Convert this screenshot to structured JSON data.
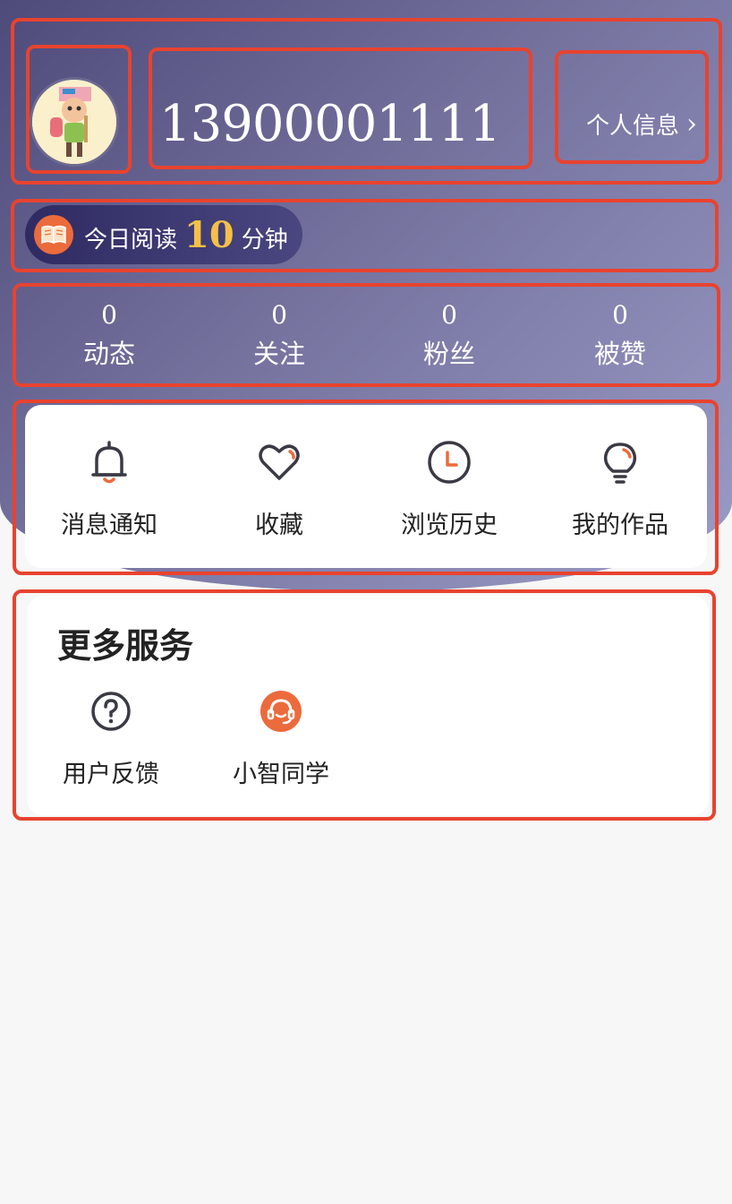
{
  "profile": {
    "phone": "13900001111",
    "info_link_label": "个人信息",
    "chevron": "›",
    "avatar_icon": "cartoon-avatar"
  },
  "reading": {
    "prefix": "今日阅读",
    "minutes": "10",
    "suffix": "分钟",
    "icon": "book-icon"
  },
  "stats": [
    {
      "value": "0",
      "label": "动态"
    },
    {
      "value": "0",
      "label": "关注"
    },
    {
      "value": "0",
      "label": "粉丝"
    },
    {
      "value": "0",
      "label": "被赞"
    }
  ],
  "actions": [
    {
      "label": "消息通知",
      "icon": "bell-icon"
    },
    {
      "label": "收藏",
      "icon": "heart-icon"
    },
    {
      "label": "浏览历史",
      "icon": "clock-icon"
    },
    {
      "label": "我的作品",
      "icon": "lightbulb-icon"
    }
  ],
  "services": {
    "title": "更多服务",
    "items": [
      {
        "label": "用户反馈",
        "icon": "question-icon"
      },
      {
        "label": "小智同学",
        "icon": "headset-icon"
      }
    ]
  },
  "colors": {
    "accent": "#ec6b3c",
    "highlight_box": "#e8432f",
    "reading_number": "#f4c048",
    "icon_stroke": "#3a3a44"
  }
}
